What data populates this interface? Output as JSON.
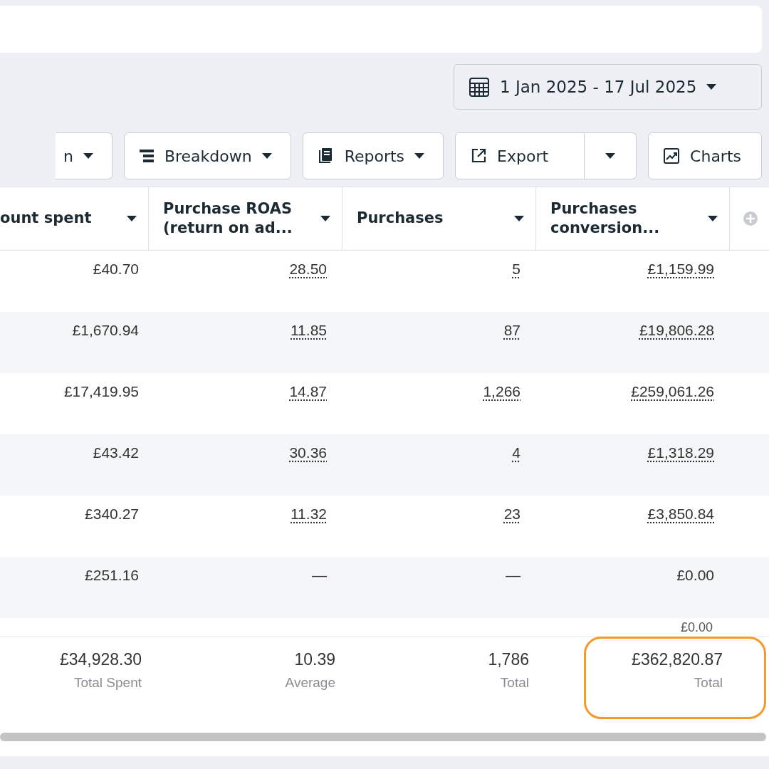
{
  "date_range": {
    "label": "1 Jan 2025 - 17 Jul 2025"
  },
  "toolbar": [
    {
      "kind": "cut",
      "label": "n"
    },
    {
      "kind": "breakdown",
      "label": "Breakdown"
    },
    {
      "kind": "reports",
      "label": "Reports"
    },
    {
      "kind": "export",
      "label": "Export"
    },
    {
      "kind": "charts",
      "label": "Charts"
    }
  ],
  "table": {
    "columns": [
      "ount spent",
      "Purchase ROAS (return on ad...",
      "Purchases",
      "Purchases conversion..."
    ],
    "rows": [
      {
        "cells": [
          {
            "text": "£40.70",
            "link": false
          },
          {
            "text": "28.50",
            "link": true
          },
          {
            "text": "5",
            "link": true
          },
          {
            "text": "£1,159.99",
            "link": true
          }
        ]
      },
      {
        "cells": [
          {
            "text": "£1,670.94",
            "link": false
          },
          {
            "text": "11.85",
            "link": true
          },
          {
            "text": "87",
            "link": true
          },
          {
            "text": "£19,806.28",
            "link": true
          }
        ]
      },
      {
        "cells": [
          {
            "text": "£17,419.95",
            "link": false
          },
          {
            "text": "14.87",
            "link": true
          },
          {
            "text": "1,266",
            "link": true
          },
          {
            "text": "£259,061.26",
            "link": true
          }
        ]
      },
      {
        "cells": [
          {
            "text": "£43.42",
            "link": false
          },
          {
            "text": "30.36",
            "link": true
          },
          {
            "text": "4",
            "link": true
          },
          {
            "text": "£1,318.29",
            "link": true
          }
        ]
      },
      {
        "cells": [
          {
            "text": "£340.27",
            "link": false
          },
          {
            "text": "11.32",
            "link": true
          },
          {
            "text": "23",
            "link": true
          },
          {
            "text": "£3,850.84",
            "link": true
          }
        ]
      },
      {
        "cells": [
          {
            "text": "£251.16",
            "link": false
          },
          {
            "text": "—",
            "link": false
          },
          {
            "text": "—",
            "link": false
          },
          {
            "text": "£0.00",
            "link": false
          }
        ]
      }
    ],
    "partial_row_value": "£0.00",
    "totals": [
      {
        "value": "£34,928.30",
        "label": "Total Spent",
        "highlighted": false
      },
      {
        "value": "10.39",
        "label": "Average",
        "highlighted": false
      },
      {
        "value": "1,786",
        "label": "Total",
        "highlighted": false
      },
      {
        "value": "£362,820.87",
        "label": "Total",
        "highlighted": true
      }
    ]
  }
}
